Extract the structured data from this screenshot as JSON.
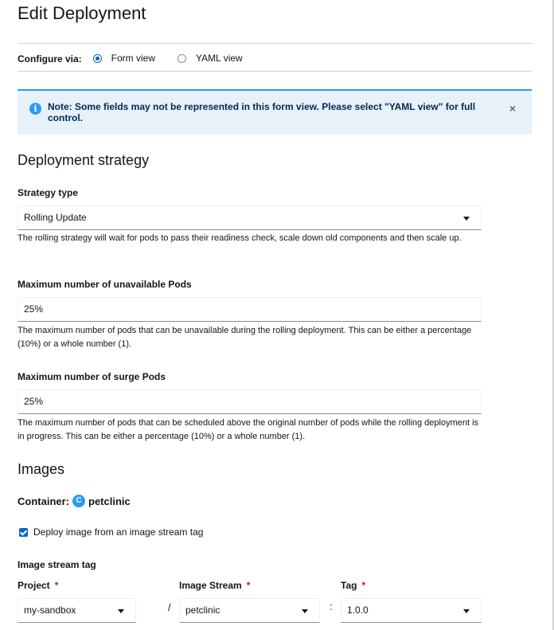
{
  "page": {
    "title": "Edit Deployment"
  },
  "configure": {
    "label": "Configure via:",
    "options": [
      {
        "label": "Form view",
        "checked": true
      },
      {
        "label": "YAML view",
        "checked": false
      }
    ]
  },
  "alert": {
    "icon": "info-icon",
    "text": "Note: Some fields may not be represented in this form view. Please select \"YAML view\" for full control.",
    "close": "×",
    "accent_color": "#2b9af3"
  },
  "strategy": {
    "heading": "Deployment strategy",
    "type_label": "Strategy type",
    "type_value": "Rolling Update",
    "type_helper": "The rolling strategy will wait for pods to pass their readiness check, scale down old components and then scale up.",
    "unavailable_label": "Maximum number of unavailable Pods",
    "unavailable_value": "25%",
    "unavailable_helper": "The maximum number of pods that can be unavailable during the rolling deployment. This can be either a percentage (10%) or a whole number (1).",
    "surge_label": "Maximum number of surge Pods",
    "surge_value": "25%",
    "surge_helper": "The maximum number of pods that can be scheduled above the original number of pods while the rolling deployment is in progress. This can be either a percentage (10%) or a whole number (1)."
  },
  "images": {
    "heading": "Images",
    "container_label": "Container:",
    "container_badge": "C",
    "container_name": "petclinic",
    "deploy_checkbox_label": "Deploy image from an image stream tag",
    "deploy_checked": true,
    "ist_label": "Image stream tag",
    "project_label": "Project",
    "project_value": "my-sandbox",
    "stream_label": "Image Stream",
    "stream_value": "petclinic",
    "tag_label": "Tag",
    "tag_value": "1.0.0",
    "required_mark": "*",
    "slash": "/",
    "colon": ":"
  }
}
